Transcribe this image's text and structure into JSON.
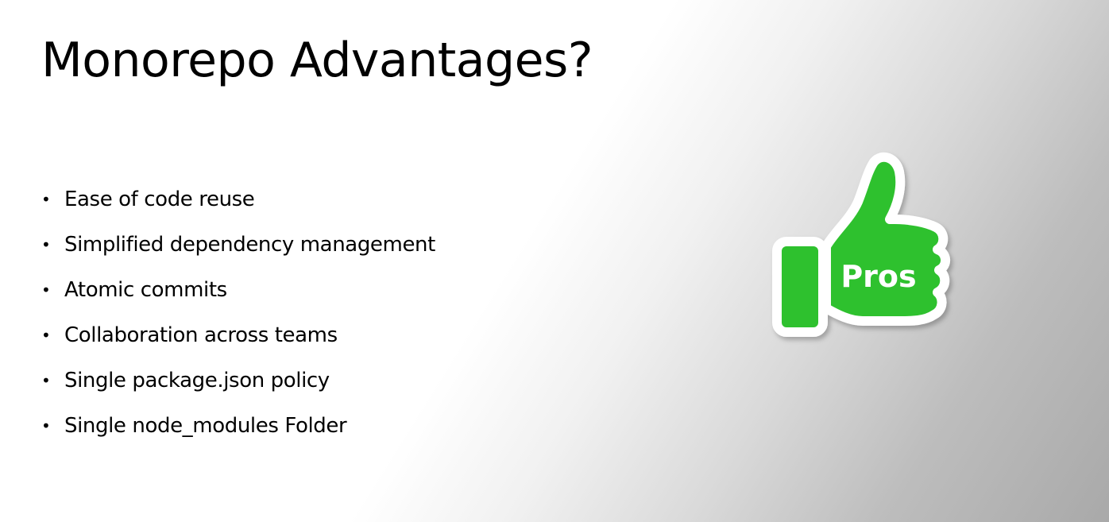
{
  "slide": {
    "title": "Monorepo Advantages?",
    "bullets": [
      "Ease of code reuse",
      "Simplified dependency management",
      "Atomic commits",
      "Collaboration across teams",
      "Single package.json policy",
      "Single node_modules Folder"
    ],
    "bullet_glyph": "•",
    "badge": {
      "icon": "thumbs-up-icon",
      "label": "Pros"
    }
  },
  "colors": {
    "thumb_green": "#2ec12e",
    "thumb_outline": "#ffffff",
    "text": "#000000"
  }
}
